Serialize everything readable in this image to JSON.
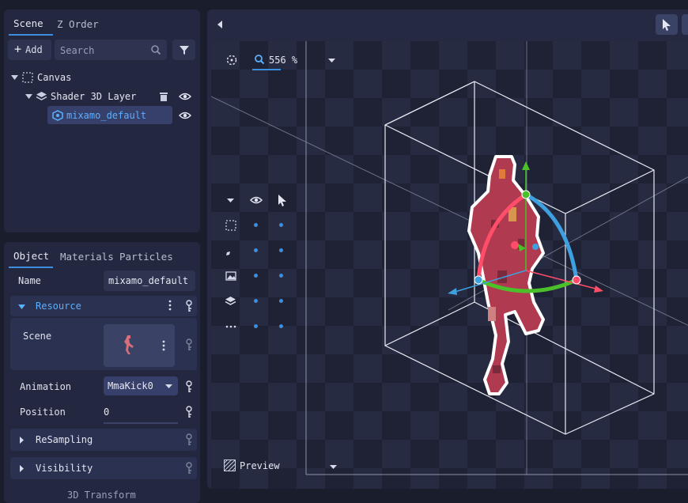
{
  "scene_panel": {
    "tabs": [
      "Scene",
      "Z Order"
    ],
    "add_label": "Add",
    "search_placeholder": "Search",
    "tree": {
      "canvas": "Canvas",
      "layer": "Shader 3D Layer",
      "node": "mixamo_default"
    }
  },
  "inspector": {
    "tabs": [
      "Object",
      "Materials",
      "Particles"
    ],
    "name_label": "Name",
    "name_value": "mixamo_default",
    "resource_section": "Resource",
    "scene_label": "Scene",
    "animation_label": "Animation",
    "animation_value": "MmaKick0",
    "position_label": "Position",
    "position_value": "0",
    "resampling_section": "ReSampling",
    "visibility_section": "Visibility",
    "transform_section": "3D Transform"
  },
  "viewport": {
    "zoom": "556 %",
    "preview_label": "Preview",
    "accent": "#3e8ede",
    "gizmo_x_color": "#ff4d6a",
    "gizmo_y_color": "#4cc02a",
    "gizmo_z_color": "#3fa0e0"
  }
}
